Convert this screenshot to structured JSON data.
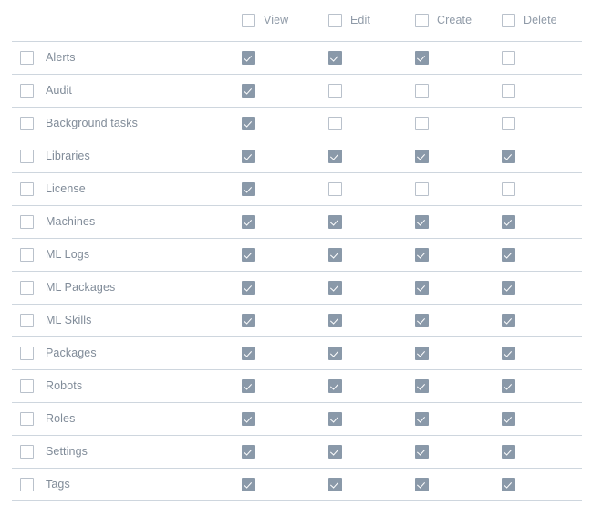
{
  "table": {
    "header": {
      "columns": [
        {
          "label": "View",
          "checked": false
        },
        {
          "label": "Edit",
          "checked": false
        },
        {
          "label": "Create",
          "checked": false
        },
        {
          "label": "Delete",
          "checked": false
        }
      ]
    },
    "rows": [
      {
        "label": "Alerts",
        "selected": false,
        "view": true,
        "edit": true,
        "create": true,
        "delete": false
      },
      {
        "label": "Audit",
        "selected": false,
        "view": true,
        "edit": false,
        "create": false,
        "delete": false
      },
      {
        "label": "Background tasks",
        "selected": false,
        "view": true,
        "edit": false,
        "create": false,
        "delete": false
      },
      {
        "label": "Libraries",
        "selected": false,
        "view": true,
        "edit": true,
        "create": true,
        "delete": true
      },
      {
        "label": "License",
        "selected": false,
        "view": true,
        "edit": false,
        "create": false,
        "delete": false
      },
      {
        "label": "Machines",
        "selected": false,
        "view": true,
        "edit": true,
        "create": true,
        "delete": true
      },
      {
        "label": "ML Logs",
        "selected": false,
        "view": true,
        "edit": true,
        "create": true,
        "delete": true
      },
      {
        "label": "ML Packages",
        "selected": false,
        "view": true,
        "edit": true,
        "create": true,
        "delete": true
      },
      {
        "label": "ML Skills",
        "selected": false,
        "view": true,
        "edit": true,
        "create": true,
        "delete": true
      },
      {
        "label": "Packages",
        "selected": false,
        "view": true,
        "edit": true,
        "create": true,
        "delete": true
      },
      {
        "label": "Robots",
        "selected": false,
        "view": true,
        "edit": true,
        "create": true,
        "delete": true
      },
      {
        "label": "Roles",
        "selected": false,
        "view": true,
        "edit": true,
        "create": true,
        "delete": true
      },
      {
        "label": "Settings",
        "selected": false,
        "view": true,
        "edit": true,
        "create": true,
        "delete": true
      },
      {
        "label": "Tags",
        "selected": false,
        "view": true,
        "edit": true,
        "create": true,
        "delete": true
      }
    ]
  },
  "colors": {
    "checked_fill": "#8a99a9",
    "unchecked_border": "#b9c1cb",
    "divider": "#ced6de",
    "header_text": "#909ba8",
    "row_text": "#818c99",
    "background": "#ffffff"
  }
}
